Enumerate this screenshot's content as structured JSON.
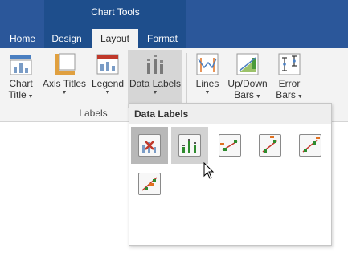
{
  "ribbon": {
    "context_title": "Chart Tools",
    "tabs": [
      "Home",
      "Design",
      "Layout",
      "Format"
    ],
    "active_tab": "Layout",
    "buttons": [
      {
        "label": "Chart",
        "label2": "Title",
        "icon": "chart-title-icon"
      },
      {
        "label": "Axis Titles",
        "label2": "",
        "icon": "axis-titles-icon"
      },
      {
        "label": "Legend",
        "label2": "",
        "icon": "legend-icon"
      },
      {
        "label": "Data Labels",
        "label2": "",
        "icon": "data-labels-icon"
      },
      {
        "label": "Lines",
        "label2": "",
        "icon": "lines-icon"
      },
      {
        "label": "Up/Down",
        "label2": "Bars",
        "icon": "up-down-bars-icon"
      },
      {
        "label": "Error",
        "label2": "Bars",
        "icon": "error-bars-icon"
      }
    ],
    "group_label": "Labels"
  },
  "gallery": {
    "title": "Data Labels",
    "items": [
      "data-labels-none-icon",
      "data-labels-default-icon",
      "data-labels-left-icon",
      "data-labels-above-icon",
      "data-labels-right-icon",
      "data-labels-below-icon"
    ]
  },
  "colors": {
    "tab_bar": "#2b579a",
    "context_band": "#1e4e8c",
    "ribbon_bg": "#f3f3f3",
    "pressed": "#d6d6d6",
    "accent_green": "#2e8b2e",
    "accent_red": "#c0392b",
    "accent_orange": "#e07020"
  }
}
